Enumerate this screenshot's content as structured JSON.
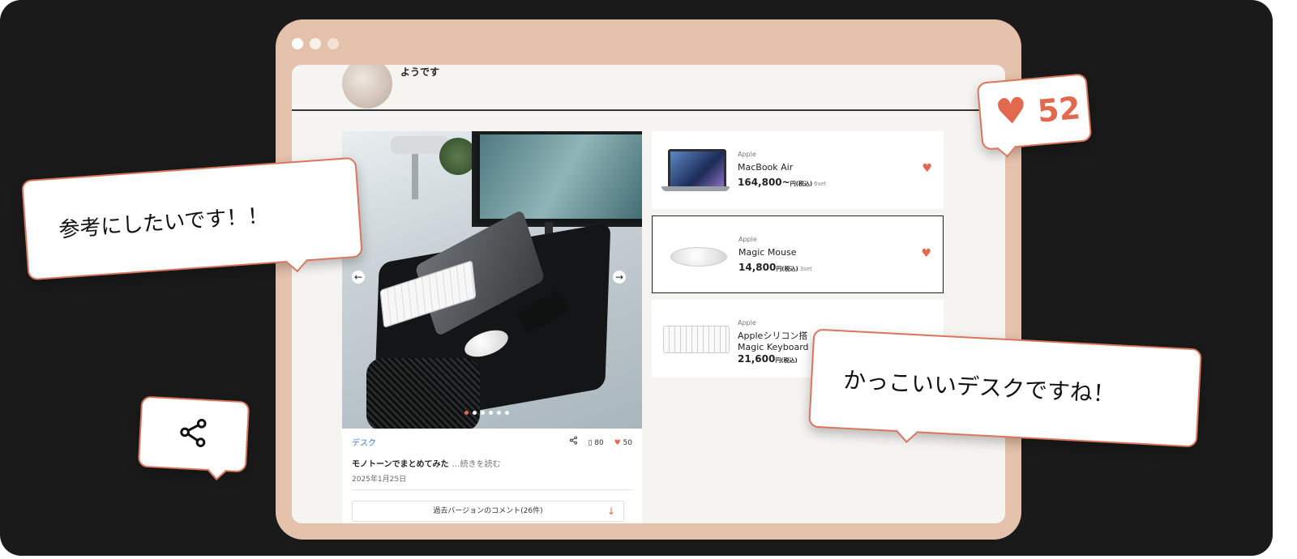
{
  "window": {
    "controls": [
      "close",
      "minimize",
      "maximize"
    ]
  },
  "profile": {
    "caption": "ようです"
  },
  "post": {
    "category": "デスク",
    "bookmark_count": "80",
    "like_count": "50",
    "title": "モノトーンでまとめてみた",
    "read_more": "…続きを読む",
    "date": "2025年1月25日",
    "comments_button": "過去バージョンのコメント(26件)",
    "carousel": {
      "total": 6,
      "current": 1
    }
  },
  "items": [
    {
      "brand": "Apple",
      "name": "MacBook Air",
      "price": "164,800~",
      "unit": "円(税込)",
      "sets": "6set"
    },
    {
      "brand": "Apple",
      "name": "Magic Mouse",
      "price": "14,800",
      "unit": "円(税込)",
      "sets": "3set"
    },
    {
      "brand": "Apple",
      "name": "Appleシリコン搭",
      "name2": "Magic Keyboard",
      "price": "21,600",
      "unit": "円(税込)",
      "sets": ""
    }
  ],
  "bubbles": {
    "comment1": "参考にしたいです！！",
    "comment2": "かっこいいデスクですね！",
    "likes": "52"
  },
  "colors": {
    "accent": "#e2684e",
    "frame": "#e4c1ab",
    "background": "#1b1a1a",
    "link": "#3a78c8"
  },
  "icons": [
    "share-icon",
    "bookmark-icon",
    "heart-icon",
    "arrow-left-icon",
    "arrow-right-icon",
    "arrow-down-icon"
  ]
}
